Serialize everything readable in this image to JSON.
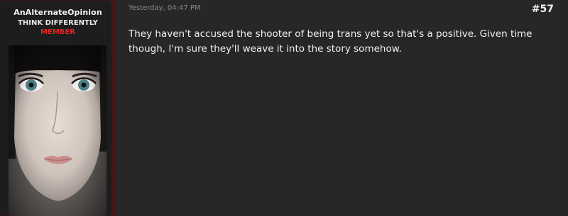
{
  "author": {
    "username": "AnAlternateOpinion",
    "title_line1": "THINK DIFFERENTLY",
    "role": "MEMBER"
  },
  "post": {
    "timestamp": "Yesterday, 04:47 PM",
    "number": "#57",
    "body": "They haven't accused the shooter of being trans yet so that's a positive. Given time though, I'm sure they'll weave it into the story somehow."
  },
  "colors": {
    "background": "#272727",
    "panel": "#1d1d1d",
    "role_red": "#e02424",
    "accent_border": "#5a1010"
  }
}
